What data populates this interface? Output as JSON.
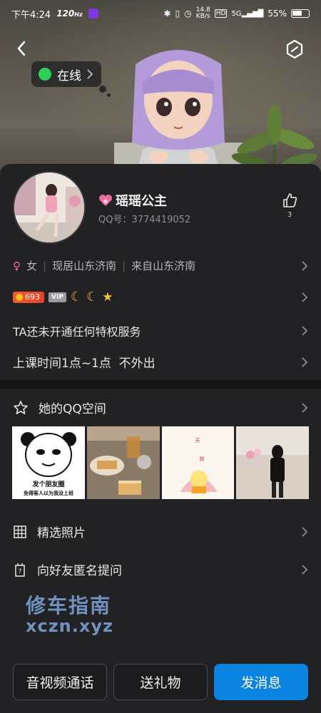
{
  "status_bar": {
    "time": "下午4:24",
    "hd_label": "120",
    "hd_sub": "Hz",
    "net_speed": "14.8",
    "net_unit": "KB/s",
    "hd_badge": "HD",
    "signal_label": "5G",
    "battery": "55%"
  },
  "header": {
    "online_label": "在线"
  },
  "profile": {
    "name": "瑶瑶公主",
    "qq_number": "QQ号：3774419052",
    "likes": "3"
  },
  "info": {
    "gender": "女",
    "residence": "现居山东济南",
    "hometown": "来自山东济南",
    "level": "693",
    "vip_label": "VIP",
    "privilege_text": "TA还未开通任何特权服务",
    "signature": "上课时间1点~1点  不外出"
  },
  "qzone": {
    "title": "她的QQ空间",
    "photos": [
      {
        "caption_line1": "发个朋友圈",
        "caption_line2": "免得客人以为我没上班"
      },
      {
        "caption_line1": "",
        "caption_line2": ""
      },
      {
        "caption_line1": "天",
        "caption_line2": "财"
      },
      {
        "caption_line1": "",
        "caption_line2": ""
      }
    ]
  },
  "menu": {
    "selected_photos": "精选照片",
    "anon_question": "向好友匿名提问"
  },
  "watermark": {
    "line1": "修车指南",
    "line2": "xczn.xyz"
  },
  "actions": {
    "av_call": "音视频通话",
    "gift": "送礼物",
    "message": "发消息"
  },
  "colors": {
    "accent": "#0a84e0",
    "online": "#2ecf5a",
    "background": "#222224"
  }
}
